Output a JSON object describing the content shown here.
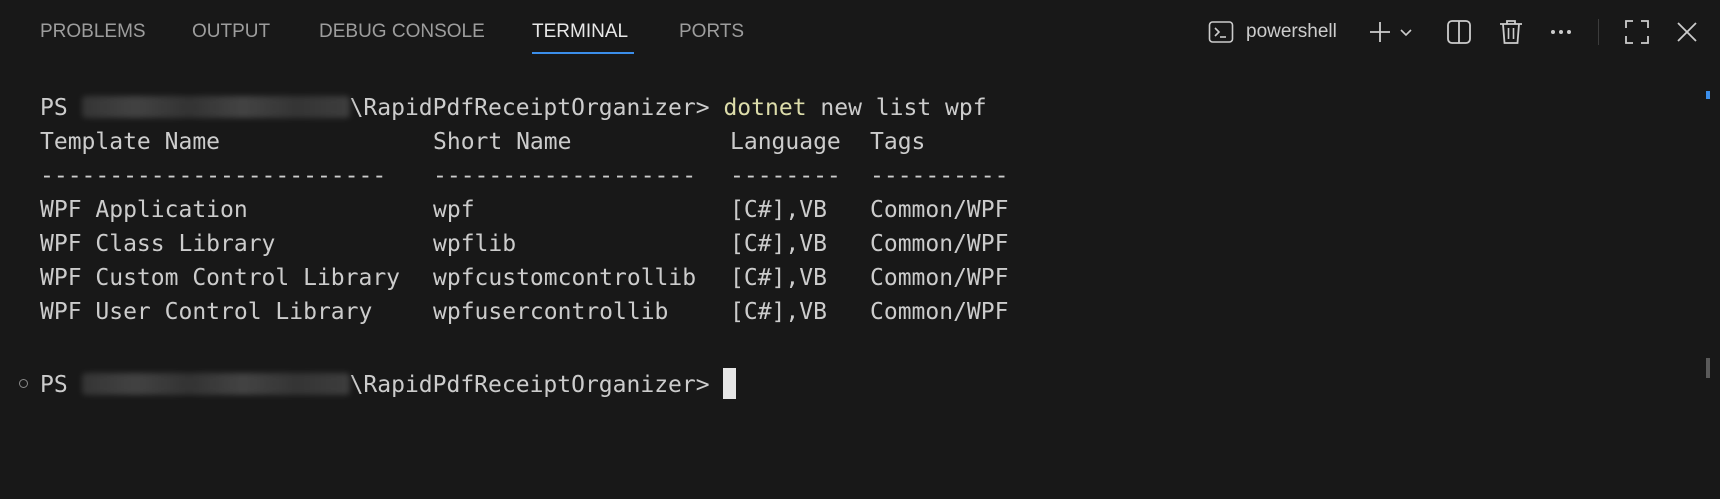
{
  "tabs": [
    {
      "label": "PROBLEMS",
      "active": false
    },
    {
      "label": "OUTPUT",
      "active": false
    },
    {
      "label": "DEBUG CONSOLE",
      "active": false
    },
    {
      "label": "TERMINAL",
      "active": true
    },
    {
      "label": "PORTS",
      "active": false
    }
  ],
  "toolbar": {
    "terminal_name": "powershell",
    "icons": [
      "terminal-shell-icon",
      "plus-icon",
      "chevron-down-icon",
      "split-icon",
      "trash-icon",
      "more-icon",
      "maximize-icon",
      "close-icon"
    ]
  },
  "terminal": {
    "prompt_prefix": "PS",
    "prompt_path_suffix": "\\RapidPdfReceiptOrganizer>",
    "command_name": "dotnet",
    "command_args": "new list wpf",
    "headers": [
      "Template Name",
      "Short Name",
      "Language",
      "Tags"
    ],
    "separators": [
      "-------------------------",
      "-------------------",
      "--------",
      "----------"
    ],
    "rows": [
      [
        "WPF Application",
        "wpf",
        "[C#],VB",
        "Common/WPF"
      ],
      [
        "WPF Class Library",
        "wpflib",
        "[C#],VB",
        "Common/WPF"
      ],
      [
        "WPF Custom Control Library",
        "wpfcustomcontrollib",
        "[C#],VB",
        "Common/WPF"
      ],
      [
        "WPF User Control Library",
        "wpfusercontrollib",
        "[C#],VB",
        "Common/WPF"
      ]
    ]
  },
  "colors": {
    "background": "#181818",
    "text": "#cccccc",
    "command": "#dcdcaa",
    "accent": "#3b8eea",
    "tab_inactive": "#9d9d9d"
  }
}
